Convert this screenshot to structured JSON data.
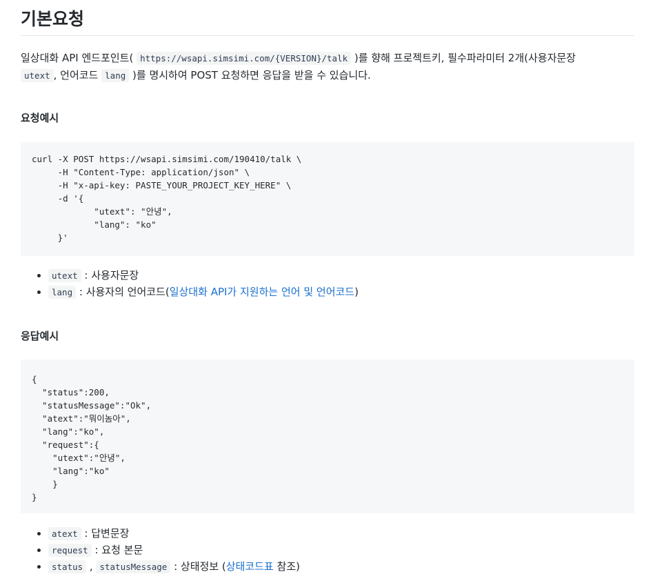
{
  "title": "기본요청",
  "intro": {
    "t1": "일상대화 API 엔드포인트( ",
    "endpoint": "https://wsapi.simsimi.com/{VERSION}/talk",
    "t2": " )를 향해 프로젝트키, 필수파라미터 2개(사용자문장",
    "utext": "utext",
    "t3": ", 언어코드 ",
    "lang": "lang",
    "t4": " )를 명시하여 POST 요청하면 응답을 받을 수 있습니다."
  },
  "request_section": {
    "heading": "요청예시",
    "code": "curl -X POST https://wsapi.simsimi.com/190410/talk \\\n     -H \"Content-Type: application/json\" \\\n     -H \"x-api-key: PASTE_YOUR_PROJECT_KEY_HERE\" \\\n     -d '{\n            \"utext\": \"안녕\",\n            \"lang\": \"ko\"\n     }'",
    "items": [
      {
        "code": "utext",
        "text": " : 사용자문장"
      },
      {
        "code": "lang",
        "text": " : 사용자의 언어코드(",
        "link": "일상대화 API가 지원하는 언어 및 언어코드",
        "after": ")"
      }
    ]
  },
  "response_section": {
    "heading": "응답예시",
    "code": "{\n  \"status\":200,\n  \"statusMessage\":\"Ok\",\n  \"atext\":\"뭐이놈아\",\n  \"lang\":\"ko\",\n  \"request\":{\n    \"utext\":\"안녕\",\n    \"lang\":\"ko\"\n    }\n}",
    "items": [
      {
        "code": "atext",
        "text": " : 답변문장"
      },
      {
        "code": "request",
        "text": " : 요청 본문"
      },
      {
        "code": "status",
        "sep": " , ",
        "code2": "statusMessage",
        "text": " : 상태정보 (",
        "link": "상태코드표",
        "after": " 참조)"
      }
    ]
  }
}
